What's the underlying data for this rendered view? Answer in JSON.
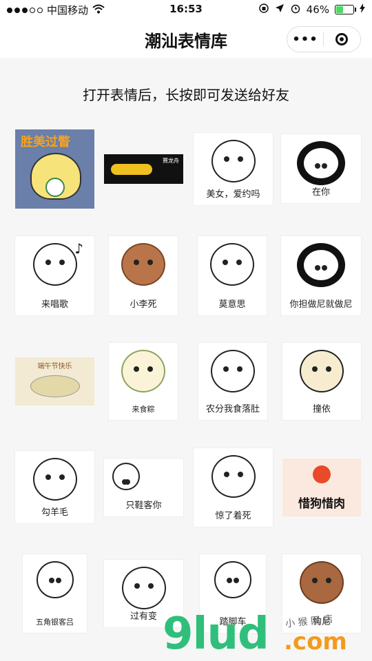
{
  "status_bar": {
    "carrier": "中国移动",
    "time": "16:53",
    "battery": "46%",
    "battery_level": 0.46
  },
  "nav": {
    "title": "潮汕表情库",
    "more": "•••"
  },
  "instruction": "打开表情后，长按即可发送给好友",
  "stickers": [
    {
      "caption": "",
      "art_text": "胜美过瞥"
    },
    {
      "caption": "",
      "art_text": "赛龙舟"
    },
    {
      "caption": "美女，爱约吗"
    },
    {
      "caption": "在你"
    },
    {
      "caption": "来唱歌"
    },
    {
      "caption": "小李死"
    },
    {
      "caption": "莫意思"
    },
    {
      "caption": "你担做尼就做尼"
    },
    {
      "caption": "",
      "art_text": "端午节快乐"
    },
    {
      "caption": "来食粽"
    },
    {
      "caption": "农分我食落肚"
    },
    {
      "caption": "撞依"
    },
    {
      "caption": "勾羊毛"
    },
    {
      "caption": "只鞋客你"
    },
    {
      "caption": "惊了着死"
    },
    {
      "caption": "",
      "art_text": "惜狗惜肉"
    },
    {
      "caption": "五角银客吕"
    },
    {
      "caption": "过有变"
    },
    {
      "caption": "踏脚车"
    },
    {
      "caption": "钩尼"
    }
  ],
  "watermark": {
    "main": "9lud",
    "domain": ".com",
    "small": "小 猴 网 店"
  },
  "colors": {
    "accent_green": "#2fbf7b",
    "accent_orange": "#f39a1d",
    "battery_green": "#4cd964"
  }
}
